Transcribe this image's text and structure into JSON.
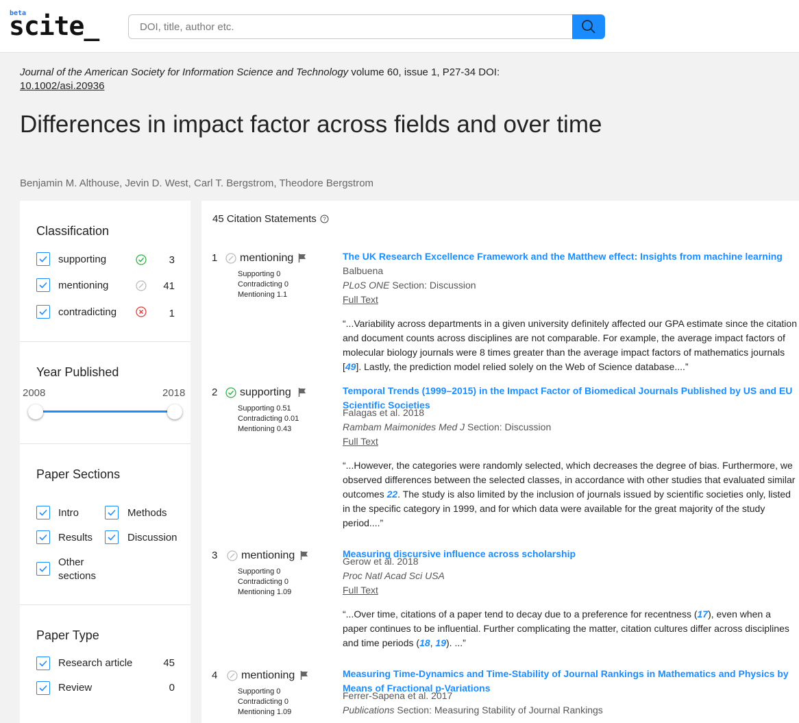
{
  "header": {
    "logo_beta": "beta",
    "logo_name": "scite_",
    "search_placeholder": "DOI, title, author etc."
  },
  "paper": {
    "journal": "Journal of the American Society for Information Science and Technology",
    "volume_info": " volume 60, issue 1, P27-34 DOI:",
    "doi": "10.1002/asi.20936",
    "title": "Differences in impact factor across fields and over time",
    "authors": "Benjamin M. Althouse, Jevin D. West, Carl T. Bergstrom, Theodore Bergstrom"
  },
  "sidebar": {
    "classification": {
      "title": "Classification",
      "items": [
        {
          "label": "supporting",
          "count": "3",
          "checked": true
        },
        {
          "label": "mentioning",
          "count": "41",
          "checked": true
        },
        {
          "label": "contradicting",
          "count": "1",
          "checked": true
        }
      ]
    },
    "year": {
      "title": "Year Published",
      "min": "2008",
      "max": "2018"
    },
    "sections": {
      "title": "Paper Sections",
      "items": [
        {
          "label": "Intro"
        },
        {
          "label": "Methods"
        },
        {
          "label": "Results"
        },
        {
          "label": "Discussion"
        },
        {
          "label": "Other sections"
        }
      ]
    },
    "paper_type": {
      "title": "Paper Type",
      "items": [
        {
          "label": "Research article",
          "count": "45"
        },
        {
          "label": "Review",
          "count": "0"
        }
      ]
    }
  },
  "main": {
    "heading": "45 Citation Statements",
    "citations": [
      {
        "num": "1",
        "classification": "mentioning",
        "supporting": "Supporting 0",
        "contradicting": "Contradicting 0",
        "mentioning": "Mentioning 1.1",
        "title": "The UK Research Excellence Framework and the Matthew effect: Insights from machine learning",
        "authors": "Balbuena",
        "journal": "PLoS ONE",
        "section": " Section: Discussion",
        "full_text": "Full Text",
        "quote_a": "“...Variability across departments in a given university definitely affected our GPA estimate since the citation and document counts across disciplines are not comparable. For example, the average impact factors of molecular biology journals were 8 times greater than the average impact factors of mathematics journals [",
        "quote_ref": "49",
        "quote_b": "]. Lastly, the prediction model relied solely on the Web of Science database....”"
      },
      {
        "num": "2",
        "classification": "supporting",
        "supporting": "Supporting 0.51",
        "contradicting": "Contradicting 0.01",
        "mentioning": "Mentioning 0.43",
        "title": "Temporal Trends (1999–2015) in the Impact Factor of Biomedical Journals Published by US and EU Scientific Societies",
        "authors": "Falagas et al. 2018",
        "journal": "Rambam Maimonides Med J",
        "section": " Section: Discussion",
        "full_text": "Full Text",
        "quote_a": "“...However, the categories were randomly selected, which decreases the degree of bias. Furthermore, we observed differences between the selected classes, in accordance with other studies that evaluated similar outcomes ",
        "quote_ref": "22",
        "quote_b": ". The study is also limited by the inclusion of journals issued by scientific societies only, listed in the specific category in 1999, and for which data were available for the great majority of the study period....”"
      },
      {
        "num": "3",
        "classification": "mentioning",
        "supporting": "Supporting 0",
        "contradicting": "Contradicting 0",
        "mentioning": "Mentioning 1.09",
        "title": "Measuring discursive influence across scholarship",
        "authors": "Gerow et al. 2018",
        "journal": "Proc Natl Acad Sci USA",
        "section": "",
        "full_text": "Full Text",
        "quote_a": "“...Over time, citations of a paper tend to decay due to a preference for recentness (",
        "quote_ref": "17",
        "quote_b": "), even when a paper continues to be influential. Further complicating the matter, citation cultures differ across disciplines and time periods (",
        "quote_ref2": "18",
        "quote_mid": ", ",
        "quote_ref3": "19",
        "quote_c": "). ...”"
      },
      {
        "num": "4",
        "classification": "mentioning",
        "supporting": "Supporting 0",
        "contradicting": "Contradicting 0",
        "mentioning": "Mentioning 1.09",
        "title": "Measuring Time-Dynamics and Time-Stability of Journal Rankings in Mathematics and Physics by Means of Fractional p-Variations",
        "authors": "Ferrer-Sapena et al. 2017",
        "journal": "Publications",
        "section": " Section: Measuring Stability of Journal Rankings"
      }
    ]
  }
}
